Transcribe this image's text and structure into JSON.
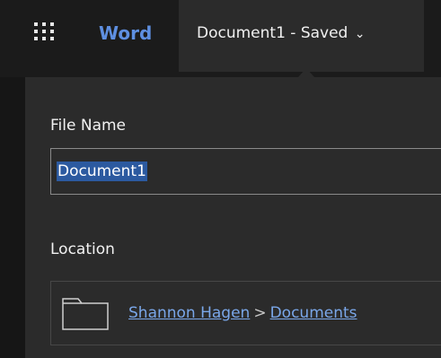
{
  "header": {
    "app_name": "Word",
    "document_title": "Document1 - Saved",
    "chevron": "⌄",
    "icons": [
      "app-launcher-icon",
      "chevron-down-icon"
    ]
  },
  "file_panel": {
    "file_name_label": "File Name",
    "file_name_value": "Document1",
    "location_label": "Location",
    "location_path": [
      "Shannon Hagen",
      "Documents"
    ],
    "separator": ">",
    "icons": [
      "folder-icon"
    ]
  },
  "colors": {
    "brand_blue": "#5e8fe0",
    "link_blue": "#7aa7e9",
    "selection": "#2c5aa0",
    "panel_bg": "#2b2b2b",
    "top_bg": "#1b1b1b"
  }
}
